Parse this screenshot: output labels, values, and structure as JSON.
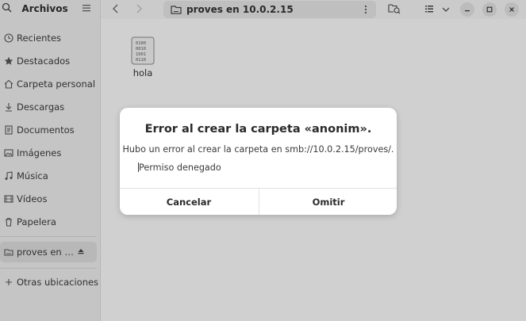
{
  "sidebar": {
    "title": "Archivos",
    "items": [
      {
        "label": "Recientes",
        "icon": "clock-icon"
      },
      {
        "label": "Destacados",
        "icon": "star-icon"
      },
      {
        "label": "Carpeta personal",
        "icon": "home-icon"
      },
      {
        "label": "Descargas",
        "icon": "download-icon"
      },
      {
        "label": "Documentos",
        "icon": "document-icon"
      },
      {
        "label": "Imágenes",
        "icon": "image-icon"
      },
      {
        "label": "Música",
        "icon": "music-icon"
      },
      {
        "label": "Vídeos",
        "icon": "video-icon"
      },
      {
        "label": "Papelera",
        "icon": "trash-icon"
      }
    ],
    "mount": {
      "label": "proves en …",
      "icon": "network-folder-icon"
    },
    "other": {
      "label": "Otras ubicaciones",
      "icon": "plus-icon"
    }
  },
  "header": {
    "path": "proves en 10.0.2.15"
  },
  "content": {
    "files": [
      {
        "name": "hola",
        "icon": "binary-file-icon"
      }
    ]
  },
  "dialog": {
    "title": "Error al crear la carpeta «anonim».",
    "message": "Hubo un error al crear la carpeta en smb://10.0.2.15/proves/.",
    "detail": "Permiso denegado",
    "cancel_label": "Cancelar",
    "skip_label": "Omitir"
  }
}
